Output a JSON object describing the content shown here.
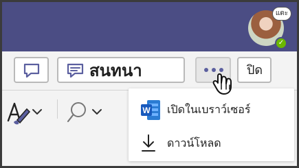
{
  "profile": {
    "badge": "แตะ",
    "icon": "person-photo-avatar",
    "status_icon": "available-check-icon"
  },
  "toolbar": {
    "comment_icon": "comment-icon",
    "conversation_label": "สนทนา",
    "more_icon": "ellipsis-icon",
    "close_label": "ปิด",
    "accent": "#5b5f9f"
  },
  "secondary_toolbar": {
    "format_icon": "text-format-brush-icon",
    "search_icon": "search-icon",
    "chevron_icon": "chevron-down-icon"
  },
  "dropdown": {
    "items": [
      {
        "label": "เปิดในเบราว์เซอร์",
        "icon": "word-icon"
      },
      {
        "label": "ดาวน์โหลด",
        "icon": "download-icon"
      }
    ]
  },
  "colors": {
    "top_bar": "#4b4d84",
    "word_blue": "#185abd",
    "presence_green": "#6bb700"
  }
}
